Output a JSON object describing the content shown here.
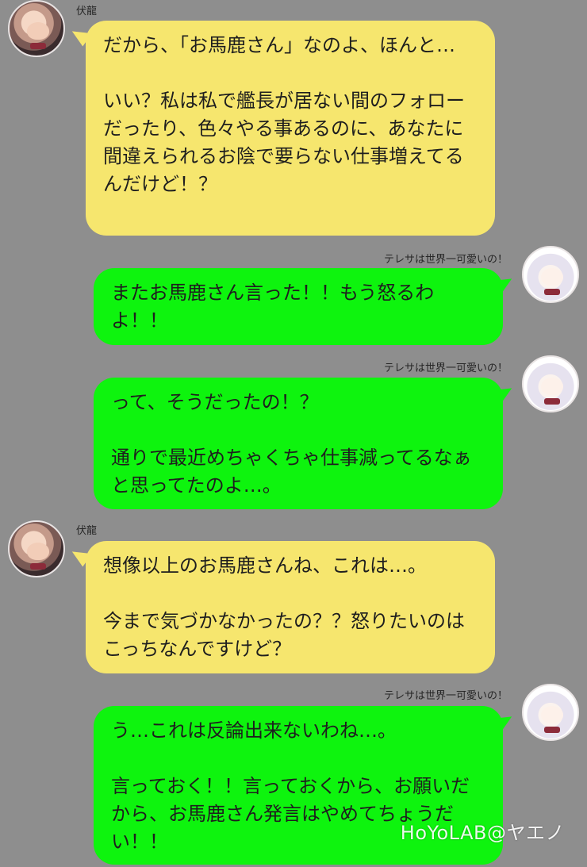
{
  "messages": [
    {
      "side": "left",
      "sender": "伏龍",
      "text": "だから、「お馬鹿さん」なのよ、ほんと…\n\nいい？私は私で艦長が居ない間のフォローだったり、色々やる事あるのに、あなたに間違えられるお陰で要らない仕事増えてるんだけど！？"
    },
    {
      "side": "right",
      "sender": "テレサは世界一可愛いの！",
      "text": "またお馬鹿さん言った！！もう怒るわよ！！"
    },
    {
      "side": "right",
      "sender": "テレサは世界一可愛いの！",
      "text": "って、そうだったの！？\n\n通りで最近めちゃくちゃ仕事減ってるなぁと思ってたのよ…。"
    },
    {
      "side": "left",
      "sender": "伏龍",
      "text": "想像以上のお馬鹿さんね、これは…。\n\n今まで気づかなかったの？？怒りたいのはこっちなんですけど？"
    },
    {
      "side": "right",
      "sender": "テレサは世界一可愛いの！",
      "text": "う…これは反論出来ないわね…。\n\n言っておく！！言っておくから、お願いだから、お馬鹿さん発言はやめてちょうだい！！"
    }
  ],
  "watermark": "HoYoLAB@ヤエノ",
  "colors": {
    "background": "#8e8e8e",
    "left_bubble": "#f6e66e",
    "right_bubble": "#0ef40e"
  }
}
